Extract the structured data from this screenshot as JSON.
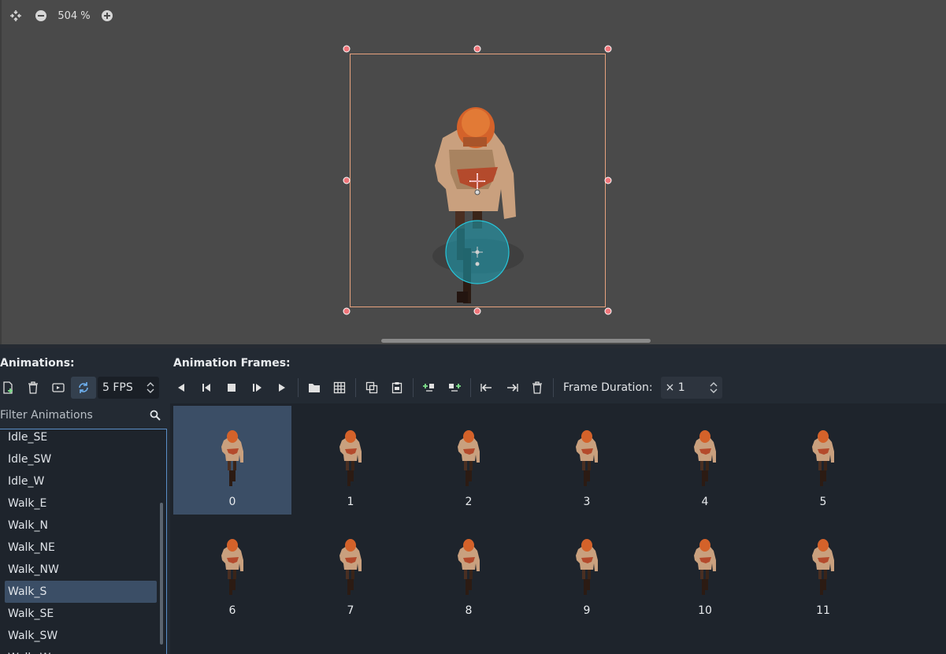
{
  "viewport": {
    "zoom_label": "504 %",
    "tools": [
      {
        "icon": "center-view-icon"
      },
      {
        "icon": "zoom-out-icon"
      },
      {
        "icon": "zoom-in-icon"
      }
    ]
  },
  "panel": {
    "animations_title": "Animations:",
    "frames_title": "Animation Frames:",
    "fps_value": "5 FPS",
    "frame_duration_label": "Frame Duration:",
    "frame_duration_value": "× 1",
    "filter_placeholder": "Filter Animations",
    "animations": [
      "Idle_SE",
      "Idle_SW",
      "Idle_W",
      "Walk_E",
      "Walk_N",
      "Walk_NE",
      "Walk_NW",
      "Walk_S",
      "Walk_SE",
      "Walk_SW",
      "Walk_W"
    ],
    "selected_animation": "Walk_S",
    "frames": [
      "0",
      "1",
      "2",
      "3",
      "4",
      "5",
      "6",
      "7",
      "8",
      "9",
      "10",
      "11"
    ],
    "selected_frame": "0"
  },
  "colors": {
    "accent": "#5a8fc8",
    "selection": "#3b4e66",
    "handle": "#f0757a",
    "sprite_box": "#e8a27e",
    "collision": "#1aa3b8"
  }
}
